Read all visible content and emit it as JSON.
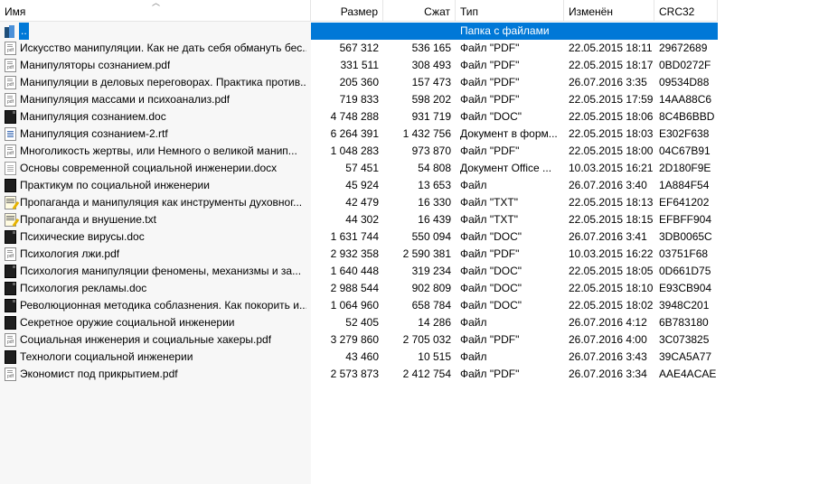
{
  "columns": {
    "name": "Имя",
    "size": "Размер",
    "packed": "Сжат",
    "type": "Тип",
    "modified": "Изменён",
    "crc": "CRC32"
  },
  "rows": [
    {
      "name": "..",
      "size": "",
      "packed": "",
      "type": "Папка с файлами",
      "modified": "",
      "crc": "",
      "icon": "folder-up-icon",
      "selected": true
    },
    {
      "name": "Искусство манипуляции. Как не дать себя обмануть бес...",
      "size": "567 312",
      "packed": "536 165",
      "type": "Файл \"PDF\"",
      "modified": "22.05.2015 18:11",
      "crc": "29672689",
      "icon": "pdf-file-icon"
    },
    {
      "name": "Манипуляторы сознанием.pdf",
      "size": "331 511",
      "packed": "308 493",
      "type": "Файл \"PDF\"",
      "modified": "22.05.2015 18:17",
      "crc": "0BD0272F",
      "icon": "pdf-file-icon"
    },
    {
      "name": "Манипуляции в деловых переговорах. Практика против...",
      "size": "205 360",
      "packed": "157 473",
      "type": "Файл \"PDF\"",
      "modified": "26.07.2016 3:35",
      "crc": "09534D88",
      "icon": "pdf-file-icon"
    },
    {
      "name": "Манипуляция массами и психоанализ.pdf",
      "size": "719 833",
      "packed": "598 202",
      "type": "Файл \"PDF\"",
      "modified": "22.05.2015 17:59",
      "crc": "14AA88C6",
      "icon": "pdf-file-icon"
    },
    {
      "name": "Манипуляция сознанием.doc",
      "size": "4 748 288",
      "packed": "931 719",
      "type": "Файл \"DOC\"",
      "modified": "22.05.2015 18:06",
      "crc": "8C4B6BBD",
      "icon": "doc-file-icon"
    },
    {
      "name": "Манипуляция сознанием-2.rtf",
      "size": "6 264 391",
      "packed": "1 432 756",
      "type": "Документ в форм...",
      "modified": "22.05.2015 18:03",
      "crc": "E302F638",
      "icon": "rtf-file-icon"
    },
    {
      "name": "Многоликость жертвы, или Немного о великой манип...",
      "size": "1 048 283",
      "packed": "973 870",
      "type": "Файл \"PDF\"",
      "modified": "22.05.2015 18:00",
      "crc": "04C67B91",
      "icon": "pdf-file-icon"
    },
    {
      "name": "Основы современной социальной инженерии.docx",
      "size": "57 451",
      "packed": "54 808",
      "type": "Документ Office ...",
      "modified": "10.03.2015 16:21",
      "crc": "2D180F9E",
      "icon": "docx-file-icon"
    },
    {
      "name": "Практикум по социальной инженерии",
      "size": "45 924",
      "packed": "13 653",
      "type": "Файл",
      "modified": "26.07.2016 3:40",
      "crc": "1A884F54",
      "icon": "generic-file-icon"
    },
    {
      "name": "Пропаганда и манипуляция как инструменты духовног...",
      "size": "42 479",
      "packed": "16 330",
      "type": "Файл \"TXT\"",
      "modified": "22.05.2015 18:13",
      "crc": "EF641202",
      "icon": "txt-file-icon"
    },
    {
      "name": "Пропаганда и внушение.txt",
      "size": "44 302",
      "packed": "16 439",
      "type": "Файл \"TXT\"",
      "modified": "22.05.2015 18:15",
      "crc": "EFBFF904",
      "icon": "txt-file-icon"
    },
    {
      "name": "Психические вирусы.doc",
      "size": "1 631 744",
      "packed": "550 094",
      "type": "Файл \"DOC\"",
      "modified": "26.07.2016 3:41",
      "crc": "3DB0065C",
      "icon": "doc-file-icon"
    },
    {
      "name": "Психология лжи.pdf",
      "size": "2 932 358",
      "packed": "2 590 381",
      "type": "Файл \"PDF\"",
      "modified": "10.03.2015 16:22",
      "crc": "03751F68",
      "icon": "pdf-file-icon"
    },
    {
      "name": "Психология манипуляции феномены, механизмы и за...",
      "size": "1 640 448",
      "packed": "319 234",
      "type": "Файл \"DOC\"",
      "modified": "22.05.2015 18:05",
      "crc": "0D661D75",
      "icon": "doc-file-icon"
    },
    {
      "name": "Психология рекламы.doc",
      "size": "2 988 544",
      "packed": "902 809",
      "type": "Файл \"DOC\"",
      "modified": "22.05.2015 18:10",
      "crc": "E93CB904",
      "icon": "doc-file-icon"
    },
    {
      "name": "Революционная методика соблазнения. Как покорить и...",
      "size": "1 064 960",
      "packed": "658 784",
      "type": "Файл \"DOC\"",
      "modified": "22.05.2015 18:02",
      "crc": "3948C201",
      "icon": "doc-file-icon"
    },
    {
      "name": "Секретное оружие социальной инженерии",
      "size": "52 405",
      "packed": "14 286",
      "type": "Файл",
      "modified": "26.07.2016 4:12",
      "crc": "6B783180",
      "icon": "generic-file-icon"
    },
    {
      "name": "Социальная инженерия и социальные хакеры.pdf",
      "size": "3 279 860",
      "packed": "2 705 032",
      "type": "Файл \"PDF\"",
      "modified": "26.07.2016 4:00",
      "crc": "3C073825",
      "icon": "pdf-file-icon"
    },
    {
      "name": "Технологи социальной инженерии",
      "size": "43 460",
      "packed": "10 515",
      "type": "Файл",
      "modified": "26.07.2016 3:43",
      "crc": "39CA5A77",
      "icon": "generic-file-icon"
    },
    {
      "name": "Экономист под прикрытием.pdf",
      "size": "2 573 873",
      "packed": "2 412 754",
      "type": "Файл \"PDF\"",
      "modified": "26.07.2016 3:34",
      "crc": "AAE4ACAE",
      "icon": "pdf-file-icon"
    }
  ],
  "colors": {
    "selection": "#0078d7",
    "name_column_bg": "#f7f7f7"
  }
}
